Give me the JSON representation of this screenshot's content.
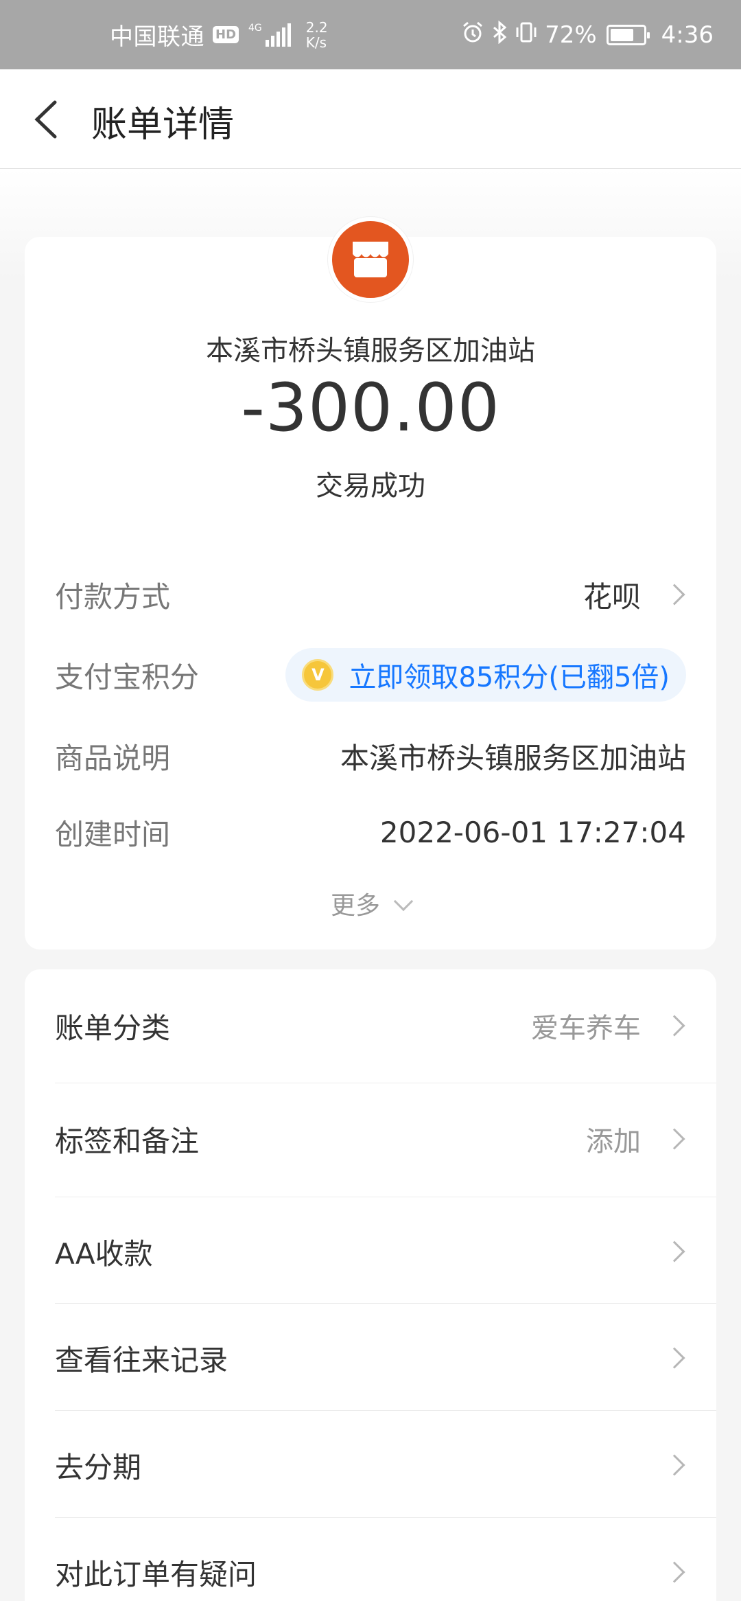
{
  "status_bar": {
    "carrier": "中国联通",
    "hd": "HD",
    "network": "4G",
    "speed_value": "2.2",
    "speed_unit": "K/s",
    "battery": "72%",
    "battery_level": 0.72,
    "time": "4:36",
    "icons": [
      "alarm-icon",
      "bluetooth-icon",
      "vibrate-icon"
    ]
  },
  "nav": {
    "title": "账单详情",
    "back_icon": "chevron-left-icon"
  },
  "summary": {
    "merchant_icon": "storefront-icon",
    "merchant_name": "本溪市桥头镇服务区加油站",
    "amount": "-300.00",
    "status": "交易成功",
    "logo_color": "#e35620"
  },
  "details": {
    "payment_method_label": "付款方式",
    "payment_method_value": "花呗",
    "points_label": "支付宝积分",
    "points_badge_glyph": "V",
    "points_value": "立即领取85积分(已翻5倍)",
    "product_label": "商品说明",
    "product_value": "本溪市桥头镇服务区加油站",
    "created_label": "创建时间",
    "created_value": "2022-06-01 17:27:04",
    "more": "更多"
  },
  "menu": {
    "items": [
      {
        "label": "账单分类",
        "value": "爱车养车"
      },
      {
        "label": "标签和备注",
        "value": "添加"
      },
      {
        "label": "AA收款",
        "value": ""
      },
      {
        "label": "查看往来记录",
        "value": ""
      },
      {
        "label": "去分期",
        "value": ""
      },
      {
        "label": "对此订单有疑问",
        "value": ""
      }
    ]
  },
  "colors": {
    "accent": "#1677ff",
    "status_bar": "#a7a7a7",
    "background": "#f5f5f5"
  }
}
